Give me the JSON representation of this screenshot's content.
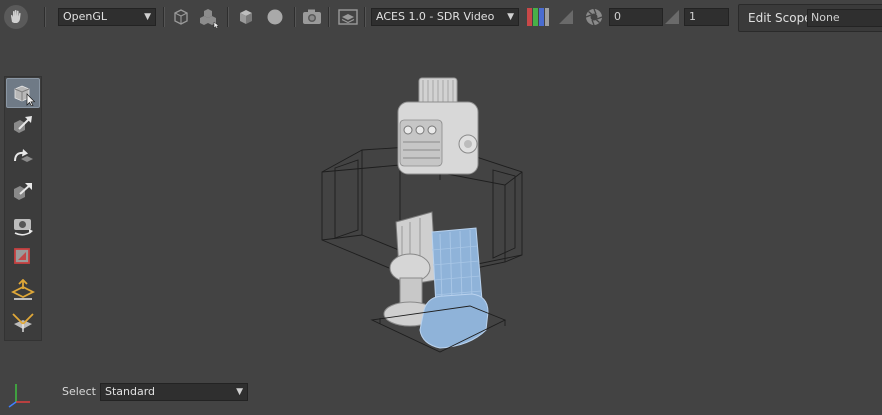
{
  "toolbar": {
    "renderer": "OpenGL",
    "color_transform": "ACES 1.0 - SDR Video",
    "exposure_value": "0",
    "gamma_value": "1",
    "edit_scope_label": "Edit Scope",
    "edit_scope_value": "None"
  },
  "bottom": {
    "select_label": "Select",
    "select_value": "Standard"
  },
  "icons": {
    "pan": "hand-icon",
    "channels": "rgb-channels-icon",
    "exposure": "aperture-icon"
  },
  "colors": {
    "background": "#434343",
    "selection": "#8fb3d9",
    "active_tool": "#6f7a86",
    "axis_x": "#e04040",
    "axis_y": "#40c040",
    "axis_z": "#4080ff"
  }
}
